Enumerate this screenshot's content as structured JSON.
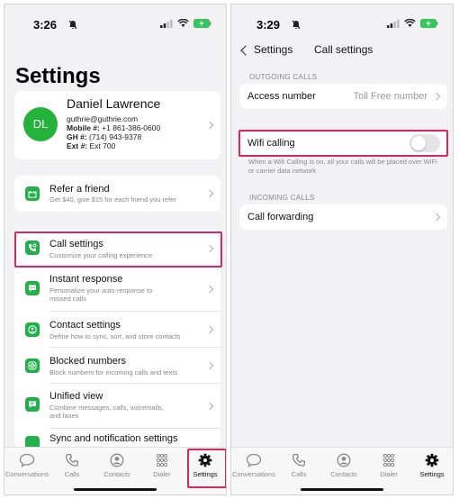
{
  "left": {
    "status_time": "3:26",
    "title": "Settings",
    "profile": {
      "initials": "DL",
      "name": "Daniel Lawrence",
      "email": "guthrie@guthrie.com",
      "mobile_label": "Mobile #:",
      "mobile_value": "+1 861-386-0600",
      "gh_label": "GH #:",
      "gh_value": "(714) 943-9378",
      "ext_label": "Ext #:",
      "ext_value": "Ext 700"
    },
    "refer": {
      "title": "Refer a friend",
      "subtitle": "Get $40, give $15 for each friend you refer"
    },
    "menu": [
      {
        "title": "Call settings",
        "subtitle": "Customize your calling experience",
        "icon": "phone-gear-icon"
      },
      {
        "title": "Instant response",
        "subtitle": "Personalize your auto-response to missed calls",
        "icon": "chat-bubble-icon"
      },
      {
        "title": "Contact settings",
        "subtitle": "Define how to sync, sort, and store contacts",
        "icon": "contact-icon"
      },
      {
        "title": "Blocked numbers",
        "subtitle": "Block numbers for incoming calls and texts",
        "icon": "block-icon"
      },
      {
        "title": "Unified view",
        "subtitle": "Combine messages, calls, voicemails, and faxes",
        "icon": "unified-icon"
      },
      {
        "title": "Sync and notification settings",
        "subtitle": "",
        "icon": "sync-icon"
      }
    ]
  },
  "right": {
    "status_time": "3:29",
    "back_label": "Settings",
    "nav_title": "Call settings",
    "outgoing_header": "OUTGOING CALLS",
    "access_label": "Access number",
    "access_value": "Toll Free number",
    "wifi_label": "Wifi calling",
    "wifi_enabled": false,
    "wifi_help": "When a Wifi Calling is on, all your calls will be placed over WiFi or carrier data network.",
    "incoming_header": "INCOMING CALLS",
    "forwarding_label": "Call forwarding"
  },
  "tabs": [
    {
      "label": "Conversations",
      "icon": "conversations-icon"
    },
    {
      "label": "Calls",
      "icon": "calls-icon"
    },
    {
      "label": "Contacts",
      "icon": "contacts-icon"
    },
    {
      "label": "Dialer",
      "icon": "dialer-icon"
    },
    {
      "label": "Settings",
      "icon": "gear-icon"
    }
  ],
  "colors": {
    "accent_green": "#21b04a",
    "highlight": "#d8285f",
    "background": "#f2f2f4"
  }
}
